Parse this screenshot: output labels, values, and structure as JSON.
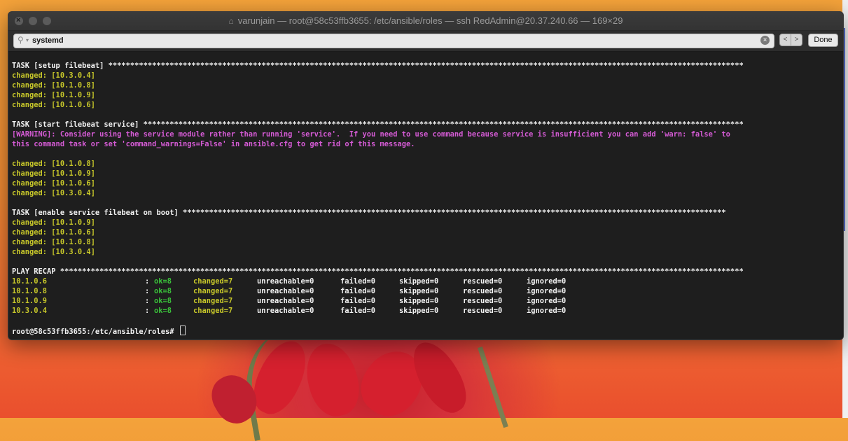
{
  "window": {
    "title": "varunjain — root@58c53ffb3655: /etc/ansible/roles — ssh RedAdmin@20.37.240.66 — 169×29"
  },
  "find_bar": {
    "query": "systemd",
    "done_label": "Done",
    "prev_label": "<",
    "next_label": ">"
  },
  "terminal": {
    "task1": {
      "header": "TASK [setup filebeat] *************************************************************************************************************************************************",
      "items": [
        "changed: [10.3.0.4]",
        "changed: [10.1.0.8]",
        "changed: [10.1.0.9]",
        "changed: [10.1.0.6]"
      ]
    },
    "task2": {
      "header": "TASK [start filebeat service] *****************************************************************************************************************************************",
      "warning_line1": "[WARNING]: Consider using the service module rather than running 'service'.  If you need to use command because service is insufficient you can add 'warn: false' to",
      "warning_line2": "this command task or set 'command_warnings=False' in ansible.cfg to get rid of this message.",
      "items": [
        "changed: [10.1.0.8]",
        "changed: [10.1.0.9]",
        "changed: [10.1.0.6]",
        "changed: [10.3.0.4]"
      ]
    },
    "task3": {
      "header": "TASK [enable service filebeat on boot] ****************************************************************************************************************************",
      "items": [
        "changed: [10.1.0.9]",
        "changed: [10.1.0.6]",
        "changed: [10.1.0.8]",
        "changed: [10.3.0.4]"
      ]
    },
    "recap": {
      "header": "PLAY RECAP ************************************************************************************************************************************************************",
      "rows": [
        {
          "host": "10.1.0.6",
          "ok": "ok=8",
          "changed": "changed=7",
          "unreachable": "unreachable=0",
          "failed": "failed=0",
          "skipped": "skipped=0",
          "rescued": "rescued=0",
          "ignored": "ignored=0"
        },
        {
          "host": "10.1.0.8",
          "ok": "ok=8",
          "changed": "changed=7",
          "unreachable": "unreachable=0",
          "failed": "failed=0",
          "skipped": "skipped=0",
          "rescued": "rescued=0",
          "ignored": "ignored=0"
        },
        {
          "host": "10.1.0.9",
          "ok": "ok=8",
          "changed": "changed=7",
          "unreachable": "unreachable=0",
          "failed": "failed=0",
          "skipped": "skipped=0",
          "rescued": "rescued=0",
          "ignored": "ignored=0"
        },
        {
          "host": "10.3.0.4",
          "ok": "ok=8",
          "changed": "changed=7",
          "unreachable": "unreachable=0",
          "failed": "failed=0",
          "skipped": "skipped=0",
          "rescued": "rescued=0",
          "ignored": "ignored=0"
        }
      ]
    },
    "prompt": "root@58c53ffb3655:/etc/ansible/roles# "
  },
  "colors": {
    "changed": "#c7c72a",
    "ok": "#3ac23a",
    "warning": "#d55bd5",
    "terminal_bg": "#1e1e1e"
  }
}
